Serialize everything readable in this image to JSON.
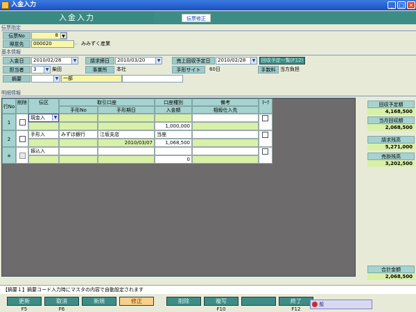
{
  "window": {
    "title": "入金入力",
    "min": "_",
    "max": "□",
    "close": "×"
  },
  "header": {
    "screen_title": "入金入力",
    "mode": "伝票修正"
  },
  "slip": {
    "section": "伝票指定",
    "no_label": "伝票No",
    "no_value": "8",
    "customer_label": "得意先",
    "customer_code": "000020",
    "customer_name": "みみずく産業"
  },
  "basic": {
    "section": "基本情報",
    "date_label": "入金日",
    "date_value": "2010/02/28",
    "bill_date_label": "請求締日",
    "bill_date_value": "2010/03/20",
    "collect_date_label": "売上回収予定日",
    "collect_date_value": "2010/02/28",
    "collect_button": "回収予定一覧(F12)",
    "staff_label": "担当者",
    "staff_code": "3",
    "staff_name": "柴田",
    "office_label": "事業所",
    "office_value": "本社",
    "site_label": "手形サイト",
    "site_value": "60日",
    "fee_label": "手数料",
    "fee_value": "当方負担",
    "memo_label": "摘要",
    "memo_code": "",
    "memo_text": "一部"
  },
  "detail": {
    "section": "明細情報",
    "headers": {
      "rowno": "行No",
      "delete": "削除",
      "kind": "伝区",
      "account": "取引口座",
      "note_no": "手形No",
      "due_date": "手形期日",
      "acct_type": "口座種別",
      "amount": "入金額",
      "memo": "備考",
      "offset": "相殺仕入先",
      "mark": "ﾏｰｸ"
    },
    "rows": [
      {
        "no": "1",
        "kind": "現金入",
        "bank": "",
        "branch": "",
        "note_no": "",
        "due": "",
        "type": "",
        "amount": "1,000,000",
        "memo": "",
        "offset": ""
      },
      {
        "no": "2",
        "kind": "手形入",
        "bank": "みずほ銀行",
        "branch": "江坂支店",
        "note_no": "",
        "due": "2010/03/07",
        "type": "当座",
        "amount": "1,068,500",
        "memo": "",
        "offset": ""
      },
      {
        "no": "＊",
        "kind": "振込入",
        "bank": "",
        "branch": "",
        "note_no": "",
        "due": "",
        "type": "",
        "amount": "0",
        "memo": "",
        "offset": ""
      }
    ]
  },
  "summary": {
    "collect_label": "回収予定額",
    "collect_value": "4,168,500",
    "month_label": "当月回収額",
    "month_value": "2,068,500",
    "bill_label": "請求残高",
    "bill_value": "5,271,000",
    "sales_label": "売掛残高",
    "sales_value": "3,202,500",
    "total_label": "合計金額",
    "total_value": "2,068,500"
  },
  "status_text": "【摘要１】摘要コード入力時にマスタの内容で自動設定されます",
  "fkeys": [
    {
      "label": "更新",
      "key": "F5"
    },
    {
      "label": "取消",
      "key": "F6"
    },
    {
      "label": "新規",
      "key": ""
    },
    {
      "label": "修正",
      "key": ""
    },
    {
      "label": "削除",
      "key": ""
    },
    {
      "label": "複写",
      "key": "F10"
    },
    {
      "label": "",
      "key": ""
    },
    {
      "label": "終了",
      "key": "F12"
    }
  ],
  "tray": {
    "text": "般"
  }
}
